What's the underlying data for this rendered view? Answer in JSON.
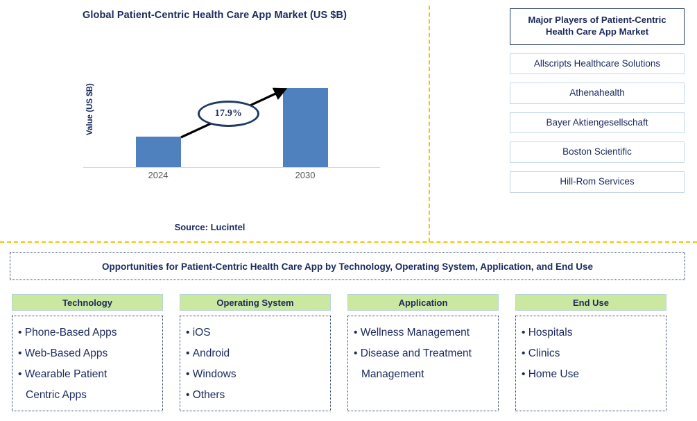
{
  "chart_data": {
    "type": "bar",
    "title": "Global Patient-Centric Health Care App Market (US $B)",
    "xlabel": "",
    "ylabel": "Value (US $B)",
    "categories": [
      "2024",
      "2030"
    ],
    "values": [
      44,
      114
    ],
    "value_unit": "relative bar height (px); absolute values not labeled",
    "annotation": "17.9%",
    "annotation_meaning": "CAGR 2024-2030",
    "grid": false,
    "legend": "none",
    "bar_color": "#4e81bd",
    "axis_color": "#d9d9d9",
    "source": "Source: Lucintel"
  },
  "chart_panel": {
    "title": "Global Patient-Centric Health Care App Market (US $B)",
    "y_axis_label": "Value (US $B)",
    "tick_2024": "2024",
    "tick_2030": "2030",
    "cagr_label": "17.9%",
    "source": "Source: Lucintel"
  },
  "players_panel": {
    "header": "Major Players of Patient-Centric Health Care App Market",
    "items": [
      "Allscripts Healthcare Solutions",
      "Athenahealth",
      "Bayer Aktiengesellschaft",
      "Boston Scientific",
      "Hill-Rom Services"
    ]
  },
  "opportunities": {
    "banner": "Opportunities for Patient-Centric Health Care App by Technology, Operating System, Application, and End Use",
    "columns": [
      {
        "header": "Technology",
        "items": [
          "Phone-Based Apps",
          "Web-Based Apps",
          "Wearable Patient\nCentric Apps"
        ]
      },
      {
        "header": "Operating System",
        "items": [
          "iOS",
          "Android",
          "Windows",
          "Others"
        ]
      },
      {
        "header": "Application",
        "items": [
          "Wellness Management",
          "Disease and Treatment\nManagement"
        ]
      },
      {
        "header": "End Use",
        "items": [
          "Hospitals",
          "Clinics",
          "Home Use"
        ]
      }
    ]
  },
  "colors": {
    "navy": "#1b2a5e",
    "bar_blue": "#4e81bd",
    "header_green": "#cbe8a0",
    "divider_yellow": "#ffc000",
    "player_border": "#c3d6e8"
  }
}
